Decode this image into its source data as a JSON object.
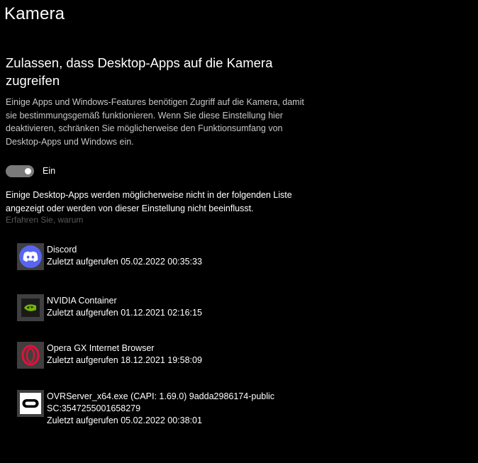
{
  "page": {
    "title": "Kamera"
  },
  "section": {
    "heading": "Zulassen, dass Desktop-Apps auf die Kamera zugreifen",
    "description": "Einige Apps und Windows-Features benötigen Zugriff auf die Kamera, damit sie bestimmungsgemäß funktionieren. Wenn Sie diese Einstellung hier deaktivieren, schränken Sie möglicherweise den Funktionsumfang von Desktop-Apps und Windows ein."
  },
  "toggle": {
    "state": "on",
    "label": "Ein"
  },
  "note": {
    "text": "Einige Desktop-Apps werden möglicherweise nicht in der folgenden Liste angezeigt oder werden von dieser Einstellung nicht beeinflusst.",
    "link": "Erfahren Sie, warum"
  },
  "apps": [
    {
      "name": "Discord",
      "last_access": "Zuletzt aufgerufen 05.02.2022 00:35:33",
      "icon": "discord-icon",
      "icon_color": "#5865f2"
    },
    {
      "name": "NVIDIA Container",
      "last_access": "Zuletzt aufgerufen 01.12.2021 02:16:15",
      "icon": "nvidia-icon",
      "icon_color": "#76b900"
    },
    {
      "name": "Opera GX Internet Browser",
      "last_access": "Zuletzt aufgerufen 18.12.2021 19:58:09",
      "icon": "opera-gx-icon",
      "icon_color": "#e0113b"
    },
    {
      "name": "OVRServer_x64.exe (CAPI: 1.69.0) 9adda2986174-public",
      "sub": "SC:3547255001658279",
      "last_access": "Zuletzt aufgerufen 05.02.2022 00:38:01",
      "icon": "oculus-icon",
      "icon_color": "#ffffff"
    }
  ]
}
